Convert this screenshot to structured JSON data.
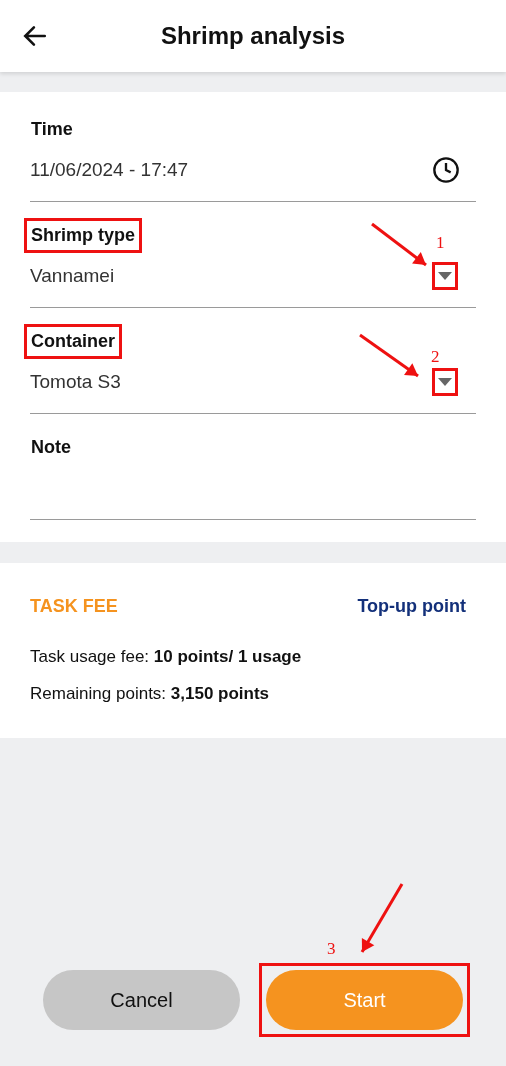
{
  "header": {
    "title": "Shrimp analysis"
  },
  "fields": [
    {
      "kind": "time",
      "label": "Time",
      "value": "11/06/2024 - 17:47",
      "highlighted": false
    },
    {
      "kind": "select",
      "label": "Shrimp type",
      "value": "Vannamei",
      "highlighted": true,
      "callout": "1"
    },
    {
      "kind": "select",
      "label": "Container",
      "value": "Tomota S3",
      "highlighted": true,
      "callout": "2"
    },
    {
      "kind": "text",
      "label": "Note",
      "highlighted": false
    }
  ],
  "task_fee": {
    "title": "TASK FEE",
    "link": "Top-up point",
    "lines": [
      "Task usage fee: **10 points/ 1 usage**",
      "Remaining points: **3,150 points**"
    ]
  },
  "buttons": [
    {
      "kind": "secondary",
      "label": "Cancel",
      "highlighted": false
    },
    {
      "kind": "primary",
      "label": "Start",
      "highlighted": true,
      "callout": "3"
    }
  ]
}
